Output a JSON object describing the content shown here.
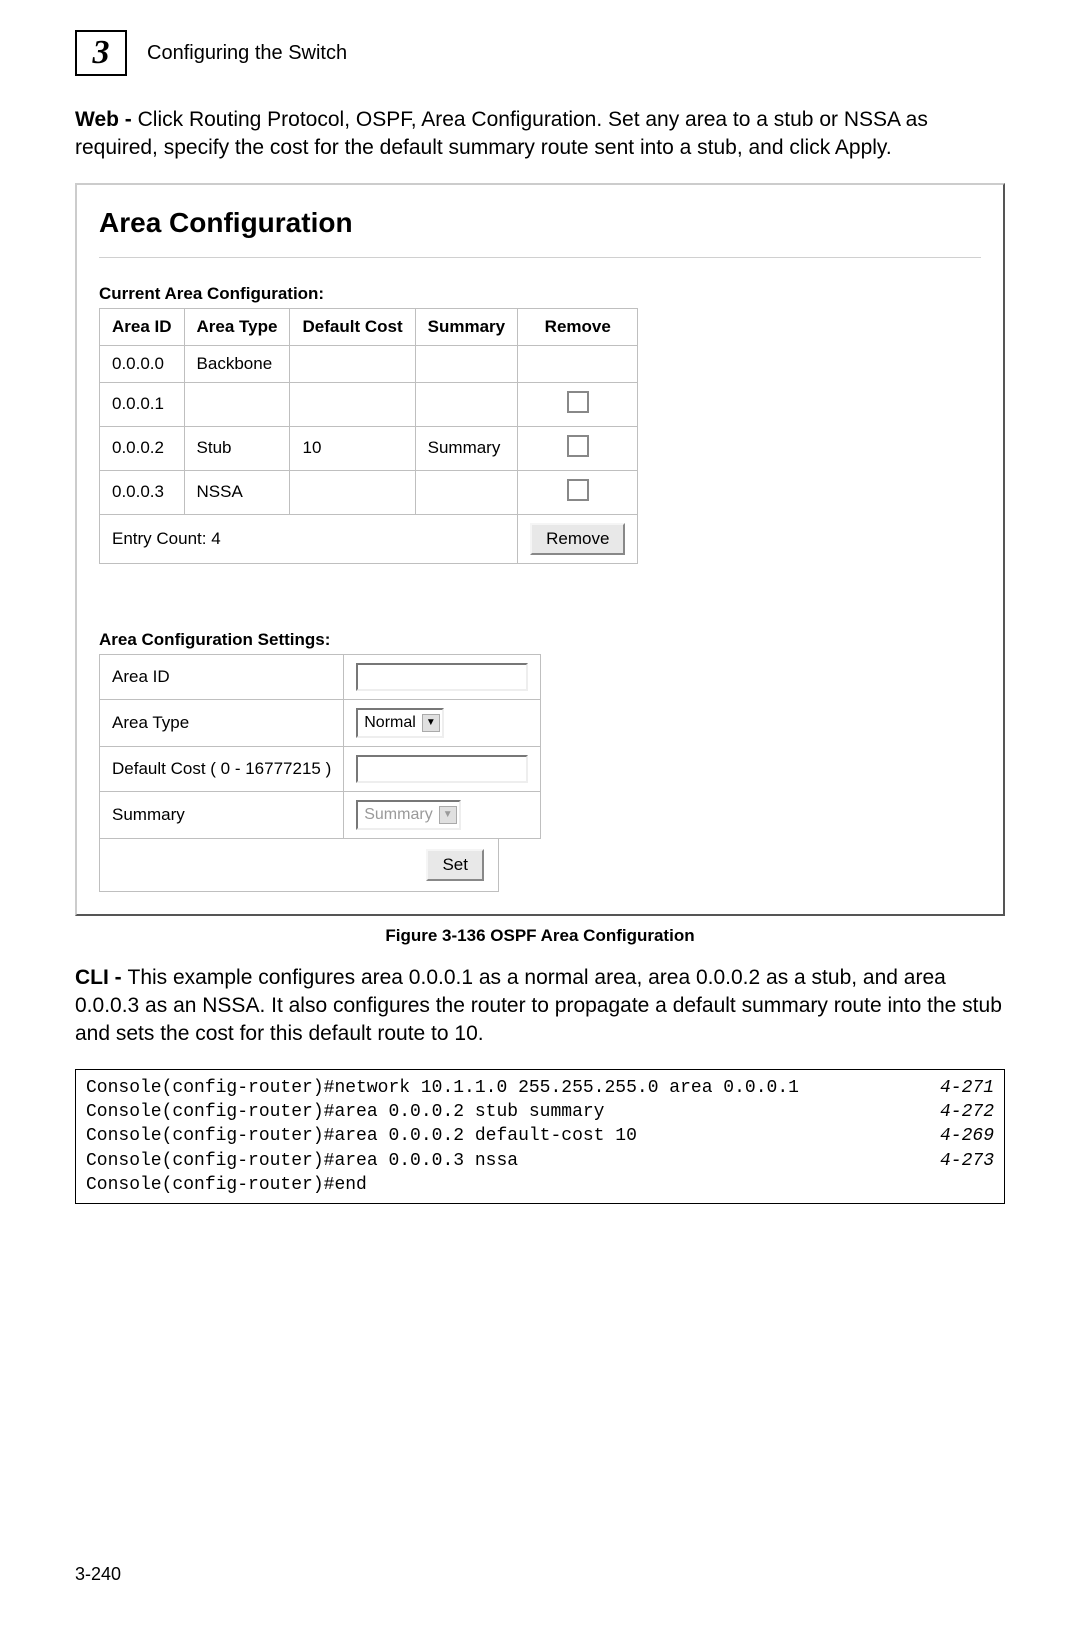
{
  "header": {
    "chapter_number": "3",
    "chapter_title": "Configuring the Switch"
  },
  "web_para_lead": "Web - ",
  "web_para_text": "Click Routing Protocol, OSPF, Area Configuration. Set any area to a stub or NSSA as required, specify the cost for the default summary route sent into a stub, and click Apply.",
  "panel": {
    "title": "Area Configuration",
    "current_label": "Current Area Configuration:",
    "cols": {
      "area_id": "Area ID",
      "area_type": "Area Type",
      "default_cost": "Default Cost",
      "summary": "Summary",
      "remove": "Remove"
    },
    "rows": [
      {
        "area_id": "0.0.0.0",
        "area_type": "Backbone",
        "default_cost": "",
        "summary": "",
        "has_remove": false
      },
      {
        "area_id": "0.0.0.1",
        "area_type": "",
        "default_cost": "",
        "summary": "",
        "has_remove": true
      },
      {
        "area_id": "0.0.0.2",
        "area_type": "Stub",
        "default_cost": "10",
        "summary": "Summary",
        "has_remove": true
      },
      {
        "area_id": "0.0.0.3",
        "area_type": "NSSA",
        "default_cost": "",
        "summary": "",
        "has_remove": true
      }
    ],
    "entry_count_label": "Entry Count: 4",
    "remove_button": "Remove",
    "settings_label": "Area Configuration Settings:",
    "settings": {
      "area_id_label": "Area ID",
      "area_id_value": "",
      "area_type_label": "Area Type",
      "area_type_value": "Normal",
      "default_cost_label": "Default Cost ( 0 - 16777215 )",
      "default_cost_value": "",
      "summary_label": "Summary",
      "summary_value": "Summary",
      "set_button": "Set"
    }
  },
  "figure_caption": "Figure 3-136   OSPF Area Configuration",
  "cli_para_lead": "CLI - ",
  "cli_para_text": "This example configures area 0.0.0.1 as a normal area, area 0.0.0.2 as a stub, and area 0.0.0.3 as an NSSA. It also configures the router to propagate a default summary route into the stub and sets the cost for this default route to 10.",
  "cli_lines": [
    {
      "cmd": "Console(config-router)#network 10.1.1.0 255.255.255.0 area 0.0.0.1",
      "ref": "4-271"
    },
    {
      "cmd": "Console(config-router)#area 0.0.0.2 stub summary",
      "ref": "4-272"
    },
    {
      "cmd": "Console(config-router)#area 0.0.0.2 default-cost 10",
      "ref": "4-269"
    },
    {
      "cmd": "Console(config-router)#area 0.0.0.3 nssa",
      "ref": "4-273"
    },
    {
      "cmd": "Console(config-router)#end",
      "ref": ""
    }
  ],
  "page_number": "3-240"
}
